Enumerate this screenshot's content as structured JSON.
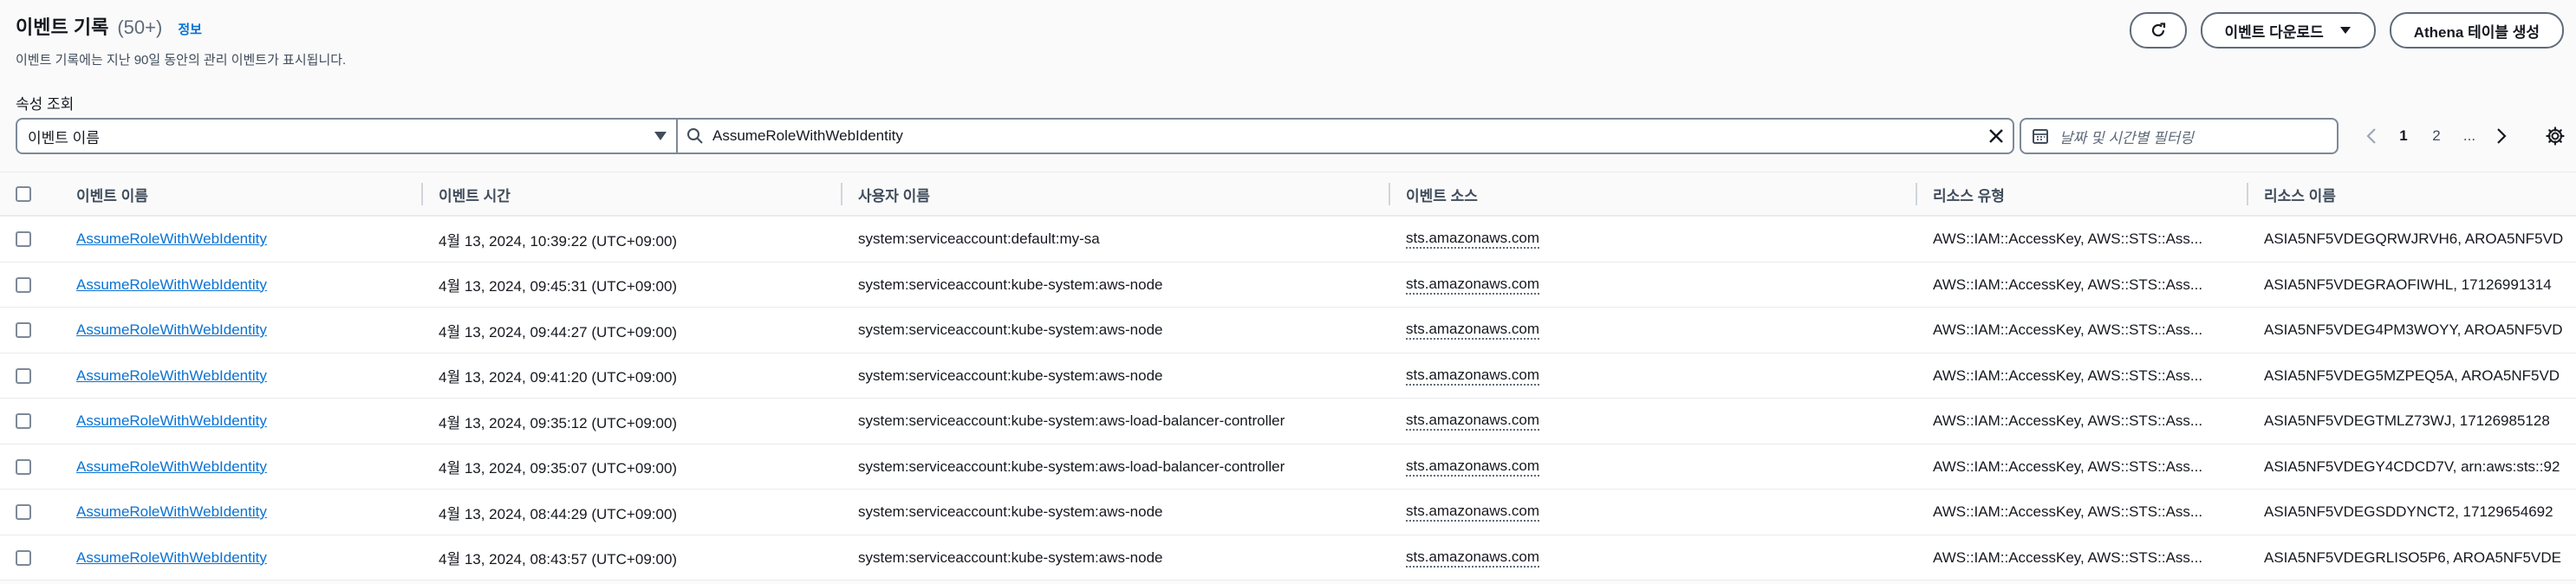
{
  "header": {
    "title": "이벤트 기록",
    "count": "(50+)",
    "info": "정보",
    "subtitle": "이벤트 기록에는 지난 90일 동안의 관리 이벤트가 표시됩니다.",
    "refresh_icon": "refresh-icon",
    "download_label": "이벤트 다운로드",
    "athena_label": "Athena 테이블 생성"
  },
  "filter": {
    "label": "속성 조회",
    "attribute": "이벤트 이름",
    "search_value": "AssumeRoleWithWebIdentity",
    "date_placeholder": "날짜 및 시간별 필터링"
  },
  "pagination": {
    "pages": [
      "1",
      "2"
    ],
    "ellipsis": "...",
    "current": "1"
  },
  "table": {
    "columns": [
      "이벤트 이름",
      "이벤트 시간",
      "사용자 이름",
      "이벤트 소스",
      "리소스 유형",
      "리소스 이름"
    ],
    "rows": [
      {
        "name": "AssumeRoleWithWebIdentity",
        "time": "4월 13, 2024, 10:39:22 (UTC+09:00)",
        "user": "system:serviceaccount:default:my-sa",
        "source": "sts.amazonaws.com",
        "rtype": "AWS::IAM::AccessKey, AWS::STS::Ass...",
        "rname": "ASIA5NF5VDEGQRWJRVH6, AROA5NF5VD"
      },
      {
        "name": "AssumeRoleWithWebIdentity",
        "time": "4월 13, 2024, 09:45:31 (UTC+09:00)",
        "user": "system:serviceaccount:kube-system:aws-node",
        "source": "sts.amazonaws.com",
        "rtype": "AWS::IAM::AccessKey, AWS::STS::Ass...",
        "rname": "ASIA5NF5VDEGRAOFIWHL, 17126991314"
      },
      {
        "name": "AssumeRoleWithWebIdentity",
        "time": "4월 13, 2024, 09:44:27 (UTC+09:00)",
        "user": "system:serviceaccount:kube-system:aws-node",
        "source": "sts.amazonaws.com",
        "rtype": "AWS::IAM::AccessKey, AWS::STS::Ass...",
        "rname": "ASIA5NF5VDEG4PM3WOYY, AROA5NF5VD"
      },
      {
        "name": "AssumeRoleWithWebIdentity",
        "time": "4월 13, 2024, 09:41:20 (UTC+09:00)",
        "user": "system:serviceaccount:kube-system:aws-node",
        "source": "sts.amazonaws.com",
        "rtype": "AWS::IAM::AccessKey, AWS::STS::Ass...",
        "rname": "ASIA5NF5VDEG5MZPEQ5A, AROA5NF5VD"
      },
      {
        "name": "AssumeRoleWithWebIdentity",
        "time": "4월 13, 2024, 09:35:12 (UTC+09:00)",
        "user": "system:serviceaccount:kube-system:aws-load-balancer-controller",
        "source": "sts.amazonaws.com",
        "rtype": "AWS::IAM::AccessKey, AWS::STS::Ass...",
        "rname": "ASIA5NF5VDEGTMLZ73WJ, 17126985128"
      },
      {
        "name": "AssumeRoleWithWebIdentity",
        "time": "4월 13, 2024, 09:35:07 (UTC+09:00)",
        "user": "system:serviceaccount:kube-system:aws-load-balancer-controller",
        "source": "sts.amazonaws.com",
        "rtype": "AWS::IAM::AccessKey, AWS::STS::Ass...",
        "rname": "ASIA5NF5VDEGY4CDCD7V, arn:aws:sts::92"
      },
      {
        "name": "AssumeRoleWithWebIdentity",
        "time": "4월 13, 2024, 08:44:29 (UTC+09:00)",
        "user": "system:serviceaccount:kube-system:aws-node",
        "source": "sts.amazonaws.com",
        "rtype": "AWS::IAM::AccessKey, AWS::STS::Ass...",
        "rname": "ASIA5NF5VDEGSDDYNCT2, 17129654692"
      },
      {
        "name": "AssumeRoleWithWebIdentity",
        "time": "4월 13, 2024, 08:43:57 (UTC+09:00)",
        "user": "system:serviceaccount:kube-system:aws-node",
        "source": "sts.amazonaws.com",
        "rtype": "AWS::IAM::AccessKey, AWS::STS::Ass...",
        "rname": "ASIA5NF5VDEGRLISO5P6, AROA5NF5VDE"
      }
    ]
  },
  "colors": {
    "link": "#0972d3",
    "text": "#16191f",
    "border": "#7d8998"
  }
}
